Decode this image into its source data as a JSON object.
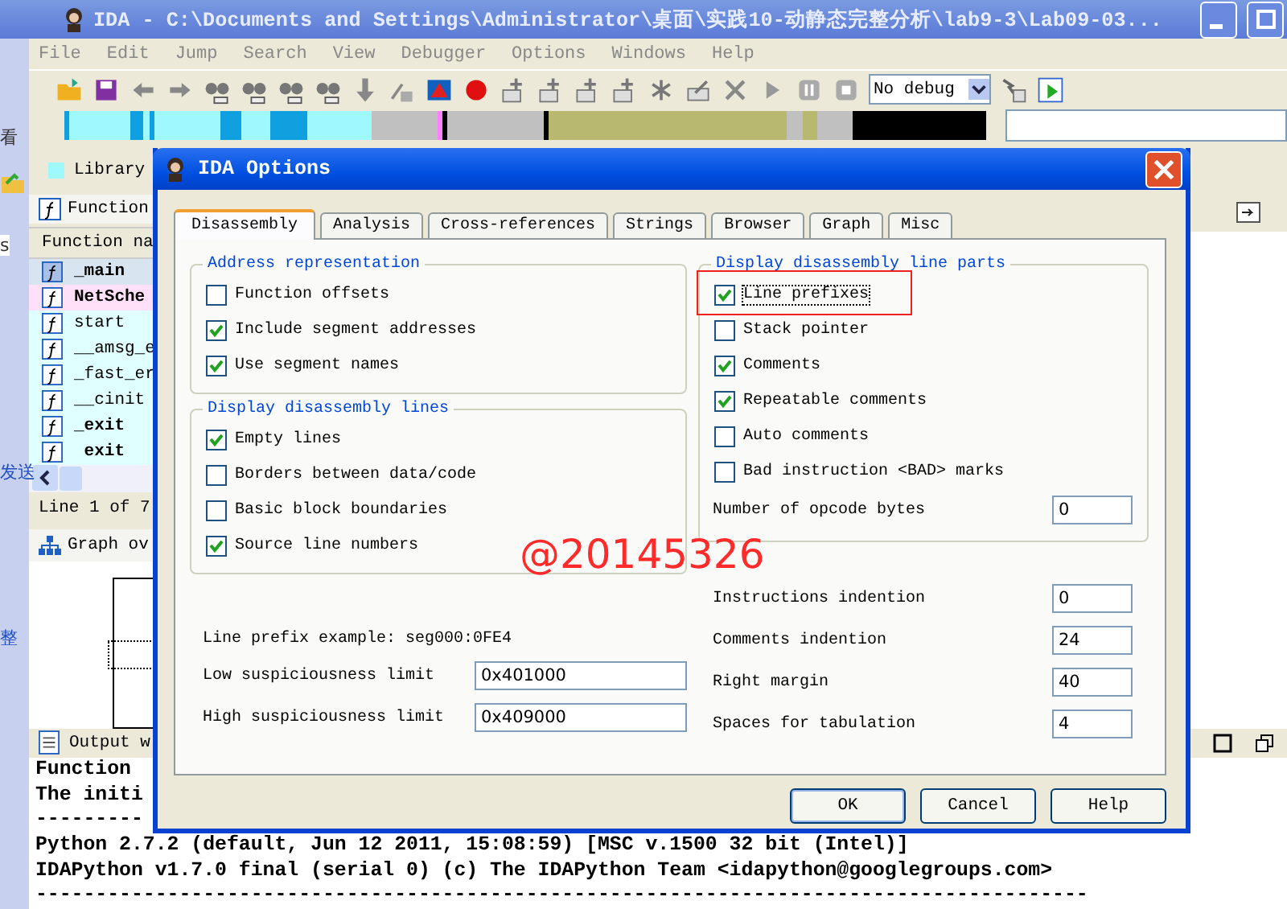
{
  "window": {
    "title": "IDA - C:\\Documents and Settings\\Administrator\\桌面\\实践10-动静态完整分析\\lab9-3\\Lab09-03..."
  },
  "menu": [
    "File",
    "Edit",
    "Jump",
    "Search",
    "View",
    "Debugger",
    "Options",
    "Windows",
    "Help"
  ],
  "toolbar": {
    "debugger_select": "No debug"
  },
  "side_strip": {
    "texts": [
      "看",
      "s",
      "发送",
      "整"
    ]
  },
  "legend": {
    "label": "Library"
  },
  "functions_window": {
    "title": "Function",
    "column": "Function na",
    "status": "Line 1 of 7",
    "rows": [
      {
        "name": "_main",
        "bold": true,
        "selected": true,
        "color": "#d8e4f0"
      },
      {
        "name": "NetSche",
        "bold": true,
        "selected": false,
        "color": "#ffe0f8"
      },
      {
        "name": "start",
        "bold": false,
        "selected": false,
        "color": "#e0ffff"
      },
      {
        "name": "__amsg_e",
        "bold": false,
        "selected": false,
        "color": "#e0ffff"
      },
      {
        "name": "_fast_er",
        "bold": false,
        "selected": false,
        "color": "#e0ffff"
      },
      {
        "name": "__cinit",
        "bold": false,
        "selected": false,
        "color": "#e0ffff"
      },
      {
        "name": "_exit",
        "bold": true,
        "selected": false,
        "color": "#e0ffff"
      },
      {
        "name": " exit",
        "bold": true,
        "selected": false,
        "color": "#e0ffff"
      }
    ]
  },
  "graph_overview": {
    "title": "Graph ov"
  },
  "output_window": {
    "title": "Output w",
    "lines": [
      "Function",
      "The initi",
      "---------",
      "Python 2.7.2 (default, Jun 12 2011, 15:08:59) [MSC v.1500 32 bit (Intel)]",
      "IDAPython v1.7.0 final (serial 0) (c) The IDAPython Team <idapython@googlegroups.com>",
      "----------------------------------------------------------------------------------------"
    ]
  },
  "dialog": {
    "title": "IDA Options",
    "tabs": [
      {
        "label": "Disassembly",
        "selected": true
      },
      {
        "label": "Analysis",
        "selected": false
      },
      {
        "label": "Cross-references",
        "selected": false
      },
      {
        "label": "Strings",
        "selected": false
      },
      {
        "label": "Browser",
        "selected": false
      },
      {
        "label": "Graph",
        "selected": false
      },
      {
        "label": "Misc",
        "selected": false
      }
    ],
    "address_group": {
      "title": "Address representation",
      "options": [
        {
          "label": "Function offsets",
          "checked": false
        },
        {
          "label": "Include segment addresses",
          "checked": true
        },
        {
          "label": "Use segment names",
          "checked": true
        }
      ]
    },
    "lines_group": {
      "title": "Display disassembly lines",
      "options": [
        {
          "label": "Empty lines",
          "checked": true
        },
        {
          "label": "Borders between data/code",
          "checked": false
        },
        {
          "label": "Basic block boundaries",
          "checked": false
        },
        {
          "label": "Source line numbers",
          "checked": true
        }
      ]
    },
    "line_prefix_example": "Line prefix example: seg000:0FE4",
    "left_fields": [
      {
        "label": "Low suspiciousness limit",
        "value": "0x401000"
      },
      {
        "label": "High suspiciousness limit",
        "value": "0x409000"
      }
    ],
    "parts_group": {
      "title": "Display disassembly line parts",
      "options": [
        {
          "label": "Line prefixes",
          "checked": true,
          "highlighted": true
        },
        {
          "label": "Stack pointer",
          "checked": false,
          "highlighted": false
        },
        {
          "label": "Comments",
          "checked": true,
          "highlighted": false
        },
        {
          "label": "Repeatable comments",
          "checked": true,
          "highlighted": false
        },
        {
          "label": "Auto comments",
          "checked": false,
          "highlighted": false
        },
        {
          "label": "Bad instruction <BAD> marks",
          "checked": false,
          "highlighted": false
        }
      ],
      "field": {
        "label": "Number of opcode bytes",
        "value": "0"
      }
    },
    "right_fields": [
      {
        "label": "Instructions indention",
        "value": "0"
      },
      {
        "label": "Comments indention",
        "value": "24"
      },
      {
        "label": "Right margin",
        "value": "40"
      },
      {
        "label": "Spaces for tabulation",
        "value": "4"
      }
    ],
    "buttons": [
      "OK",
      "Cancel",
      "Help"
    ]
  },
  "annotation": {
    "text": "@20145326"
  }
}
